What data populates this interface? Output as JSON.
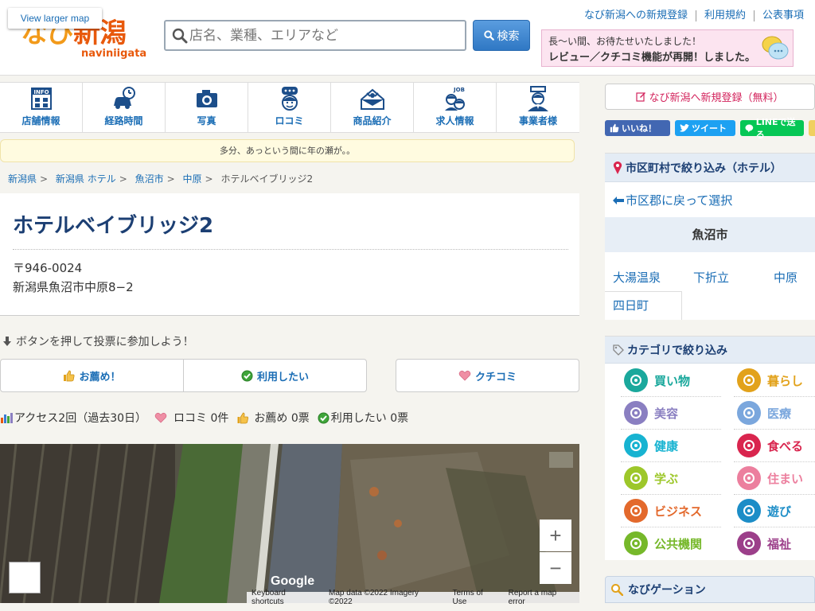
{
  "header": {
    "logo_text_kana": "なび",
    "logo_text_kanji": "新潟",
    "logo_sub": "naviniigata",
    "search_placeholder": "店名、業種、エリアなど",
    "search_button": "検索",
    "links": [
      "なび新潟への新規登録",
      "利用規約",
      "公表事項"
    ],
    "promo_line1": "長〜い間、お待たせいたしました！",
    "promo_line2": "レビュー／クチコミ機能が再開！しました。"
  },
  "nav_tabs": [
    {
      "label": "店舗情報",
      "icon": "info-icon"
    },
    {
      "label": "経路時間",
      "icon": "car-icon"
    },
    {
      "label": "写真",
      "icon": "camera-icon"
    },
    {
      "label": "ロコミ",
      "icon": "chat-icon"
    },
    {
      "label": "商品紹介",
      "icon": "gift-icon"
    },
    {
      "label": "求人情報",
      "icon": "job-icon"
    },
    {
      "label": "事業者様",
      "icon": "business-icon"
    }
  ],
  "notice": "多分、あっという間に年の瀬が。。",
  "breadcrumb": [
    "新潟県",
    "新潟県 ホテル",
    "魚沼市",
    "中原",
    "ホテルベイブリッジ2"
  ],
  "hotel": {
    "name": "ホテルベイブリッジ2",
    "postal_code": "〒946-0024",
    "address": "新潟県魚沼市中原8−2"
  },
  "vote": {
    "hint": "ボタンを押して投票に参加しよう！",
    "recommend": "お薦め！",
    "want_to_use": "利用したい",
    "review": "クチコミ"
  },
  "stats": {
    "access": "アクセス2回（過去30日）",
    "reviews": "ロコミ 0件",
    "recommend": "お薦め 0票",
    "want": "利用したい 0票"
  },
  "map": {
    "view_larger": "View larger map",
    "zoom_in": "+",
    "zoom_out": "−",
    "google": "Google",
    "footer": [
      "Keyboard shortcuts",
      "Map data ©2022 Imagery ©2022",
      "Terms of Use",
      "Report a map error"
    ]
  },
  "sidebar": {
    "register": "なび新潟へ新規登録（無料）",
    "social": {
      "like": "いいね！",
      "tweet": "ツイート",
      "line": "LINEで送る"
    },
    "area": {
      "title": "市区町村で絞り込み（ホテル）",
      "back": "市区郡に戻って選択",
      "current": "魚沼市",
      "items": [
        "大湯温泉",
        "下折立",
        "中原",
        "四日町"
      ]
    },
    "category": {
      "title": "カテゴリで絞り込み",
      "items": [
        {
          "label": "買い物",
          "color": "#1aa89c",
          "icon": "shopping-bag-icon"
        },
        {
          "label": "暮らし",
          "color": "#e2a21b",
          "icon": "family-icon"
        },
        {
          "label": "美容",
          "color": "#8a7fc1",
          "icon": "beauty-icon"
        },
        {
          "label": "医療",
          "color": "#7ba7dd",
          "icon": "medical-icon"
        },
        {
          "label": "健康",
          "color": "#17b3d1",
          "icon": "health-icon"
        },
        {
          "label": "食べる",
          "color": "#d9254e",
          "icon": "dining-icon"
        },
        {
          "label": "学ぶ",
          "color": "#9dc72a",
          "icon": "learning-icon"
        },
        {
          "label": "住まい",
          "color": "#ec7f9e",
          "icon": "house-icon"
        },
        {
          "label": "ビジネス",
          "color": "#e3692c",
          "icon": "building-icon"
        },
        {
          "label": "遊び",
          "color": "#1c8dc7",
          "icon": "camera-play-icon"
        },
        {
          "label": "公共機関",
          "color": "#76b82a",
          "icon": "public-icon"
        },
        {
          "label": "福祉",
          "color": "#9c3f8a",
          "icon": "welfare-icon"
        }
      ]
    },
    "navigation_title": "なびゲーション"
  }
}
